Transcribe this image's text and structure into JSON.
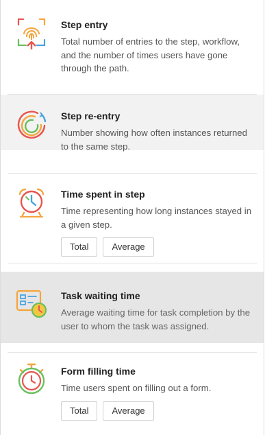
{
  "items": [
    {
      "title": "Step entry",
      "description": "Total number of entries to the step, workflow, and the number of times users have gone through the path.",
      "icon": "fingerprint-entry-icon"
    },
    {
      "title": "Step re-entry",
      "description": "Number showing how often instances returned to the same step.",
      "icon": "reentry-arcs-icon"
    },
    {
      "title": "Time spent in step",
      "description": "Time representing how long instances stayed in a given step.",
      "icon": "alarm-clock-icon",
      "buttons": [
        "Total",
        "Average"
      ]
    },
    {
      "title": "Task waiting time",
      "description": "Average waiting time for task completion by the user to whom the task was assigned.",
      "icon": "task-clock-icon"
    },
    {
      "title": "Form filling time",
      "description": "Time users spent on filling out a form.",
      "icon": "stopwatch-icon",
      "buttons": [
        "Total",
        "Average"
      ]
    }
  ],
  "colors": {
    "orange": "#f5a43c",
    "red": "#e8554e",
    "green": "#6abf5e",
    "blue": "#4aa3df",
    "yellow": "#f2c744"
  }
}
